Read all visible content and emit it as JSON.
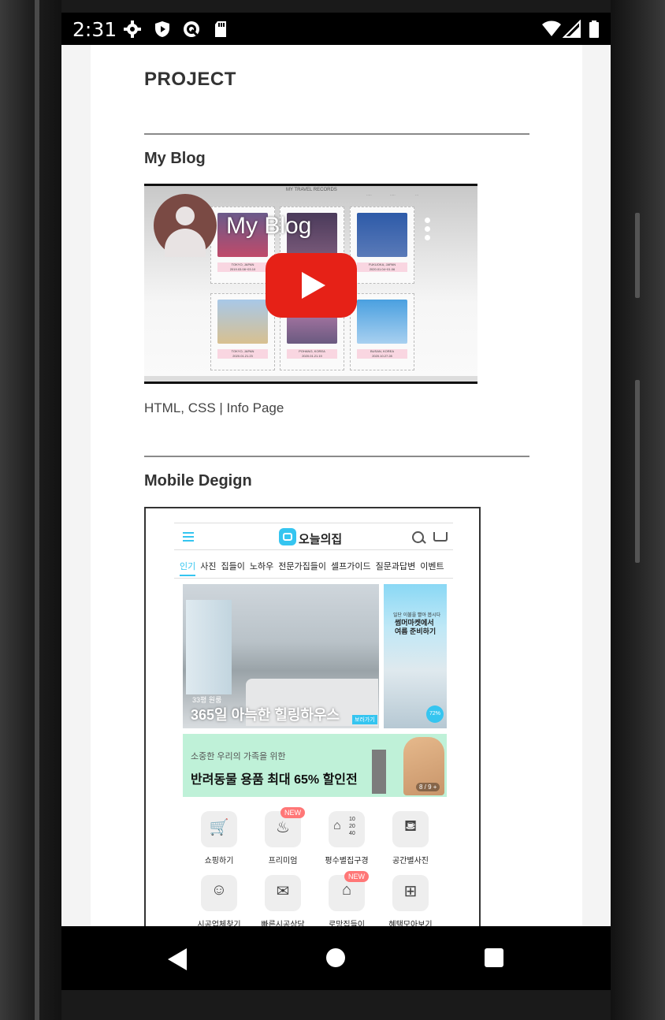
{
  "status_bar": {
    "time": "2:31",
    "icons": [
      "gear-icon",
      "shield-icon",
      "at-sign-icon",
      "sd-card-icon",
      "wifi-icon",
      "signal-icon",
      "battery-icon"
    ]
  },
  "page": {
    "title": "PROJECT",
    "projects": [
      {
        "title": "My Blog",
        "video": {
          "title": "My Blog",
          "thumbnail_header": "MY TRAVEL RECORDS",
          "cards": [
            {
              "label": "TOKYO, JAPAN",
              "date": "2019.03.08~03.10"
            },
            {
              "label": "",
              "date": ""
            },
            {
              "label": "FUKUOKA, JAPAN",
              "date": "2020.01.04~01.06"
            },
            {
              "label": "TOKYO, JAPAN",
              "date": "2020.01.21.23"
            },
            {
              "label": "POHANG, KOREA",
              "date": "2020.01.21.19"
            },
            {
              "label": "BUSAN, KOREA",
              "date": "2020.10.27.28"
            }
          ]
        },
        "caption": "HTML, CSS | Info Page"
      },
      {
        "title": "Mobile Degign",
        "mockup": {
          "logo_text": "오늘의집",
          "tabs": [
            "인기",
            "사진",
            "집들이",
            "노하우",
            "전문가집들이",
            "셀프가이드",
            "질문과답변",
            "이벤트"
          ],
          "hero": {
            "subtitle": "33평 원룸",
            "title": "365일 아늑한 힐링하우스",
            "button": "보러가기"
          },
          "side": {
            "small": "일단 이불을 빨아 봅시다",
            "title": "썸머마켓에서 여름 준비하기",
            "percent": "72%"
          },
          "banner": {
            "subtitle": "소중한 우리의 가족을 위한",
            "title": "반려동물 용품 최대 65% 할인전",
            "page": "8 / 9 +"
          },
          "categories": [
            {
              "label": "쇼핑하기",
              "icon": "shopping-cart-icon",
              "new": false
            },
            {
              "label": "프리미엄",
              "icon": "lamp-icon",
              "new": true
            },
            {
              "label": "평수별집구경",
              "icon": "house-icon",
              "new": false
            },
            {
              "label": "공간별사진",
              "icon": "sofa-icon",
              "new": false
            },
            {
              "label": "시공업체찾기",
              "icon": "worker-icon",
              "new": false
            },
            {
              "label": "빠른시공상담",
              "icon": "chat-icon",
              "new": false
            },
            {
              "label": "로망집들이",
              "icon": "window-icon",
              "new": true
            },
            {
              "label": "혜택모아보기",
              "icon": "gift-icon",
              "new": false
            }
          ],
          "new_badge": "NEW",
          "house_numbers": [
            "10",
            "20",
            "40"
          ]
        }
      }
    ]
  }
}
